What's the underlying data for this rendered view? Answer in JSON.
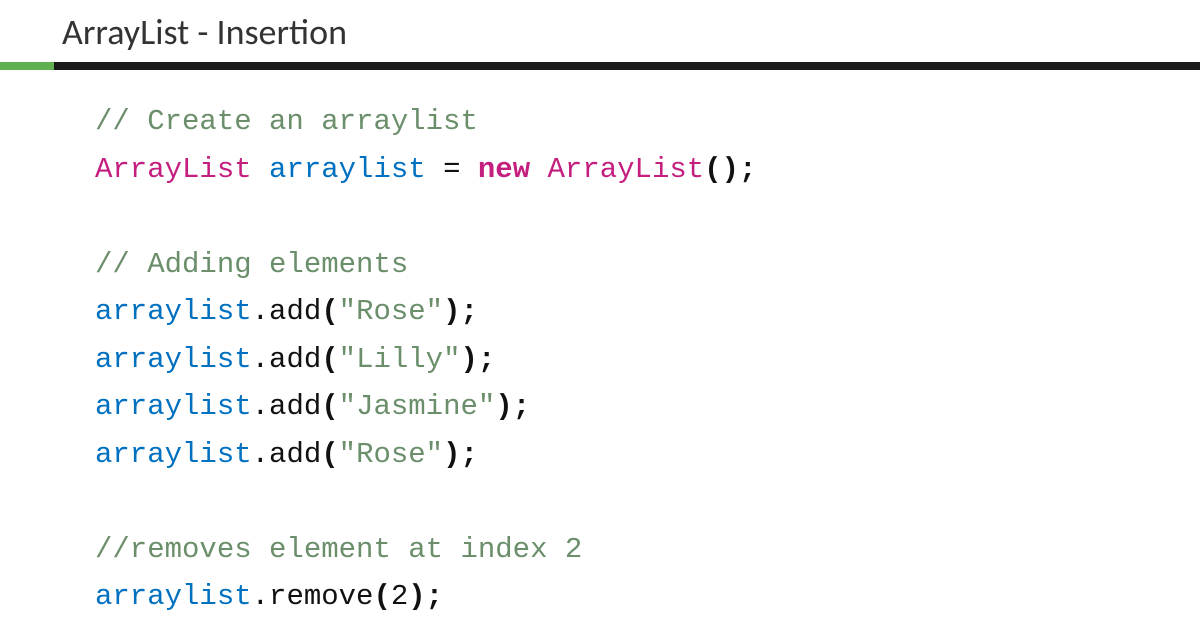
{
  "title": "ArrayList - Insertion",
  "colors": {
    "accent": "#5fb04f",
    "divider": "#1a1a1a",
    "comment": "#6b8e6b",
    "type": "#c41e7f",
    "variable": "#0070c0",
    "keyword": "#c41e7f",
    "string": "#6b8e6b",
    "punctuation": "#111111"
  },
  "code": {
    "line1_comment": "// Create an arraylist",
    "line2": {
      "type1": "ArrayList",
      "space1": " ",
      "var": "arraylist",
      "eq": " = ",
      "kw": "new",
      "space2": " ",
      "type2": "ArrayList",
      "parens": "();"
    },
    "line3_comment": "// Adding elements",
    "lines_add": [
      {
        "var": "arraylist",
        "dot": ".",
        "method": "add",
        "open": "(",
        "str": "\"Rose\"",
        "close": ");"
      },
      {
        "var": "arraylist",
        "dot": ".",
        "method": "add",
        "open": "(",
        "str": "\"Lilly\"",
        "close": ");"
      },
      {
        "var": "arraylist",
        "dot": ".",
        "method": "add",
        "open": "(",
        "str": "\"Jasmine\"",
        "close": ");"
      },
      {
        "var": "arraylist",
        "dot": ".",
        "method": "add",
        "open": "(",
        "str": "\"Rose\"",
        "close": ");"
      }
    ],
    "line8_comment": "//removes element at index 2",
    "line9": {
      "var": "arraylist",
      "dot": ".",
      "method": "remove",
      "open": "(",
      "num": "2",
      "close": ");"
    }
  }
}
